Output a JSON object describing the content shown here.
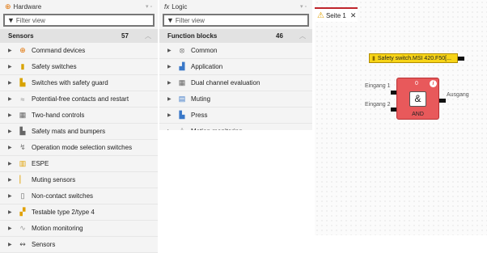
{
  "hardware": {
    "title": "Hardware",
    "pin": "▾ ▫",
    "filter_placeholder": "Filter view",
    "category": {
      "label": "Sensors",
      "count": "57"
    },
    "items": [
      {
        "label": "Command devices",
        "icon": "command-device-icon"
      },
      {
        "label": "Safety switches",
        "icon": "safety-switch-icon"
      },
      {
        "label": "Switches with safety guard",
        "icon": "switch-guard-icon"
      },
      {
        "label": "Potential-free contacts and restart",
        "icon": "contacts-icon"
      },
      {
        "label": "Two-hand controls",
        "icon": "two-hand-icon"
      },
      {
        "label": "Safety mats and bumpers",
        "icon": "safety-mat-icon"
      },
      {
        "label": "Operation mode selection switches",
        "icon": "mode-switch-icon"
      },
      {
        "label": "ESPE",
        "icon": "espe-icon"
      },
      {
        "label": "Muting sensors",
        "icon": "muting-sensor-icon"
      },
      {
        "label": "Non-contact switches",
        "icon": "non-contact-icon"
      },
      {
        "label": "Testable type 2/type 4",
        "icon": "testable-icon"
      },
      {
        "label": "Motion monitoring",
        "icon": "motion-icon"
      },
      {
        "label": "Sensors",
        "icon": "sensor-icon"
      }
    ]
  },
  "logic": {
    "title": "Logic",
    "prefix": "fx",
    "pin": "▾ ▫",
    "filter_placeholder": "Filter view",
    "category": {
      "label": "Function blocks",
      "count": "46"
    },
    "items": [
      {
        "label": "Common",
        "icon": "common-icon"
      },
      {
        "label": "Application",
        "icon": "application-icon"
      },
      {
        "label": "Dual channel evaluation",
        "icon": "dual-channel-icon"
      },
      {
        "label": "Muting",
        "icon": "muting-icon"
      },
      {
        "label": "Press",
        "icon": "press-icon"
      },
      {
        "label": "Motion monitoring",
        "icon": "motion-monitoring-icon"
      }
    ]
  },
  "canvas": {
    "tab": "Seite 1",
    "tab_close": "✕",
    "safety_switch": "Safety switch.MSI 420.F50[...",
    "input1": "Eingang 1",
    "input2": "Eingang 2",
    "output": "Ausgang",
    "block_number": "0",
    "block_symbol": "&",
    "block_name": "AND",
    "info": "i"
  },
  "colors": {
    "accent": "#c0262d",
    "block": "#e8595b",
    "switch": "#f7d417"
  }
}
